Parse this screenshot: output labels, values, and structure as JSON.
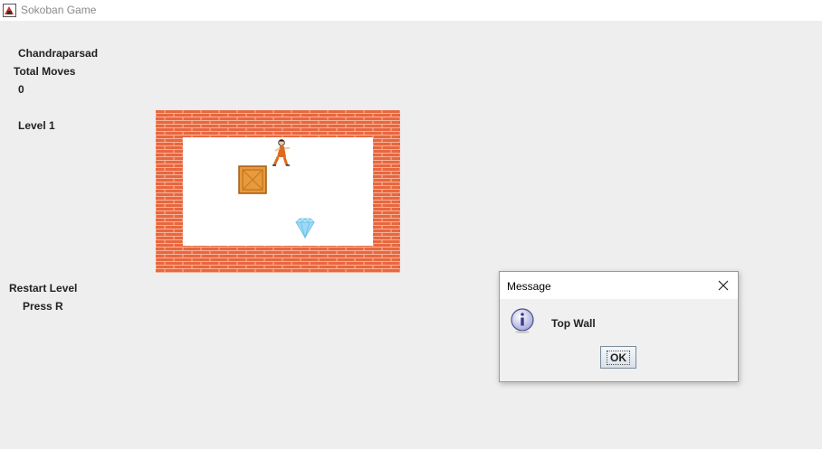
{
  "window": {
    "title": "Sokoban Game"
  },
  "sidebar": {
    "player_name": "Chandraparsad",
    "moves_label": "Total Moves",
    "moves_value": "0",
    "level_label": "Level 1",
    "restart_label": "Restart Level",
    "restart_key": "Press R"
  },
  "board": {
    "wall_color": "#e8673f",
    "floor_color": "#ffffff"
  },
  "dialog": {
    "title": "Message",
    "message": "Top Wall",
    "ok_label": "OK",
    "icon": "info-icon",
    "close_icon": "close-icon"
  }
}
